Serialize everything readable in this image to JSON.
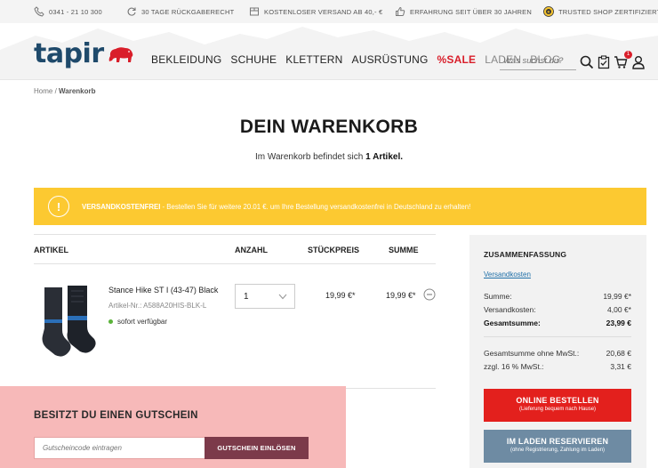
{
  "topbar": {
    "phone": "0341 - 21 10 300",
    "returns": "30 TAGE RÜCKGABERECHT",
    "shipping": "KOSTENLOSER VERSAND AB 40,- €",
    "experience": "ERFAHRUNG SEIT ÜBER 30 JAHREN",
    "trusted": "TRUSTED SHOP ZERTIFIZIERT"
  },
  "header": {
    "logo": "tapir",
    "nav": [
      "BEKLEIDUNG",
      "SCHUHE",
      "KLETTERN",
      "AUSRÜSTUNG",
      "%SALE",
      "LADEN",
      "BLOG"
    ],
    "search_placeholder": "Was suchst du?",
    "cart_count": "1"
  },
  "breadcrumb": {
    "home": "Home",
    "separator": " / ",
    "current": "Warenkorb"
  },
  "page": {
    "title": "DEIN WARENKORB",
    "subtitle_prefix": "Im Warenkorb befindet sich ",
    "subtitle_count": "1 Artikel."
  },
  "notice": {
    "icon": "!",
    "bold": "VERSANDKOSTENFREI",
    "text": " - Bestellen Sie für weitere 20.01 €. um Ihre Bestellung versandkostenfrei in Deutschland zu erhalten!"
  },
  "table": {
    "headers": {
      "article": "ARTIKEL",
      "quantity": "ANZAHL",
      "unit_price": "STÜCKPREIS",
      "total": "SUMME"
    },
    "items": [
      {
        "name": "Stance Hike ST I (43-47) Black",
        "sku": "Artikel-Nr.: A588A20HIS-BLK-L",
        "stock": "sofort verfügbar",
        "quantity": "1",
        "unit_price": "19,99 €*",
        "total": "19,99 €*"
      }
    ]
  },
  "voucher": {
    "title": "BESITZT DU EINEN GUTSCHEIN",
    "placeholder": "Gutscheincode eintragen",
    "button": "GUTSCHEIN EINLÖSEN"
  },
  "summary": {
    "title": "ZUSAMMENFASSUNG",
    "shipping_link": "Versandkosten",
    "rows": [
      {
        "label": "Summe:",
        "value": "19,99 €*"
      },
      {
        "label": "Versandkosten:",
        "value": "4,00 €*"
      },
      {
        "label": "Gesamtsumme:",
        "value": "23,99 €"
      },
      {
        "label": "Gesamtsumme ohne MwSt.:",
        "value": "20,68 €"
      },
      {
        "label": "zzgl. 16 % MwSt.:",
        "value": "3,31 €"
      }
    ],
    "order_button": "ONLINE BESTELLEN",
    "order_sub": "(Lieferung bequem nach Hause)",
    "store_button": "IM LADEN RESERVIEREN",
    "store_sub": "(ohne Registrierung, Zahlung im Laden)"
  },
  "colors": {
    "brand": "#1f4a6b",
    "accent_red": "#e3201d",
    "notice_yellow": "#fcc931",
    "voucher_bg": "#f7b9b9",
    "store_blue": "#6e8ba3"
  }
}
